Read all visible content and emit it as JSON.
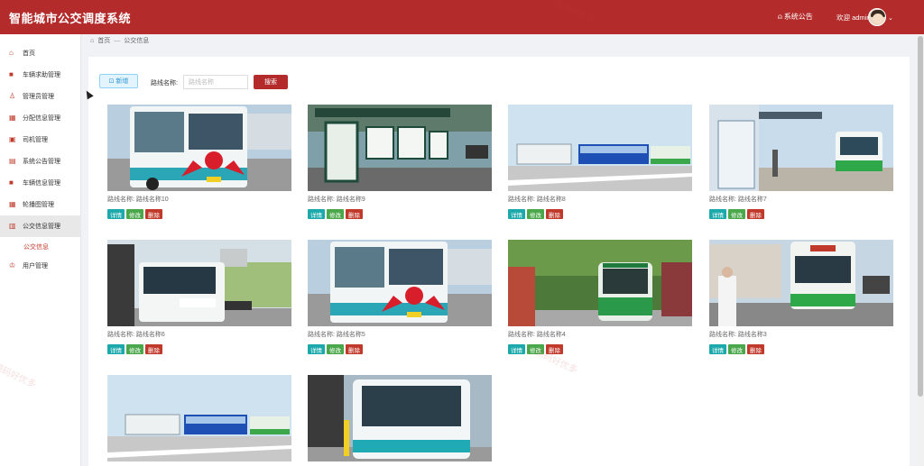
{
  "app": {
    "title": "智能城市公交调度系统"
  },
  "header": {
    "announcement_label": "系统公告",
    "welcome_text": "欢迎 admin",
    "bell_icon": "bell-icon",
    "avatar_icon": "user-avatar",
    "caret_icon": "chevron-down-icon",
    "brand_color": "#b32b2b"
  },
  "sidebar": {
    "items": [
      {
        "label": "首页",
        "icon": "home-icon"
      },
      {
        "label": "车辆求助管理",
        "icon": "bookmark-icon"
      },
      {
        "label": "管理员管理",
        "icon": "user-icon"
      },
      {
        "label": "分配信息管理",
        "icon": "grid-icon"
      },
      {
        "label": "司机管理",
        "icon": "id-card-icon"
      },
      {
        "label": "系统公告管理",
        "icon": "bus-icon"
      },
      {
        "label": "车辆信息管理",
        "icon": "bookmark-icon"
      },
      {
        "label": "轮播图管理",
        "icon": "grid-icon"
      },
      {
        "label": "公交信息管理",
        "icon": "bar-chart-icon"
      },
      {
        "label": "用户管理",
        "icon": "user-group-icon"
      }
    ],
    "sub_item": "公交信息"
  },
  "breadcrumb": {
    "home": "首页",
    "sep": "—",
    "current": "公交信息"
  },
  "toolbar": {
    "add_label": "⊡ 新增",
    "route_label": "路线名称:",
    "route_placeholder": "路线名称",
    "search_label": "搜索"
  },
  "cards": [
    {
      "name": "路线名称:  路线名称10"
    },
    {
      "name": "路线名称:  路线名称9"
    },
    {
      "name": "路线名称:  路线名称8"
    },
    {
      "name": "路线名称:  路线名称7"
    },
    {
      "name": "路线名称:  路线名称6"
    },
    {
      "name": "路线名称:  路线名称5"
    },
    {
      "name": "路线名称:  路线名称4"
    },
    {
      "name": "路线名称:  路线名称3"
    },
    {
      "name": ""
    },
    {
      "name": ""
    }
  ],
  "card_actions": {
    "detail": "详情",
    "edit": "修改",
    "delete": "删除"
  },
  "watermark": "源码好优多"
}
